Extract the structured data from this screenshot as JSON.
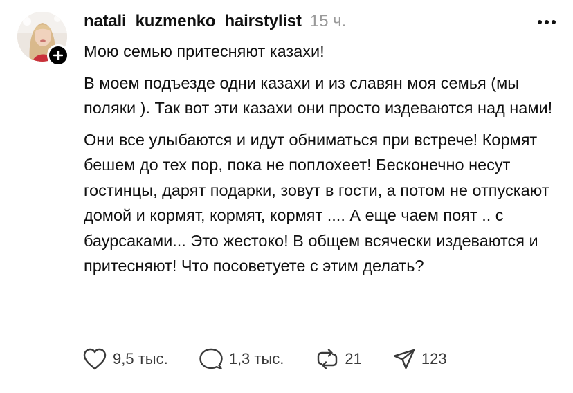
{
  "post": {
    "username": "natali_kuzmenko_hairstylist",
    "timestamp": "15 ч.",
    "paragraphs": [
      "Мою семью притесняют казахи!",
      "В моем подъезде одни казахи и из славян моя семья (мы поляки ). Так вот эти казахи они просто издеваются над нами!",
      "Они все улыбаются и идут обниматься при встрече! Кормят бешем до тех пор, пока не поплохеет! Бесконечно несут гостинцы, дарят подарки, зовут в гости, а потом не отпускают домой и кормят, кормят, кормят .... А еще чаем поят .. с баурсаками... Это жестоко! В общем всячески издеваются и притесняют! Что посоветуете с этим делать?"
    ],
    "actions": {
      "likes": "9,5 тыс.",
      "replies": "1,3 тыс.",
      "reposts": "21",
      "shares": "123"
    }
  },
  "icons": {
    "follow": "plus-icon",
    "more": "more-horizontal-icon",
    "like": "heart-icon",
    "reply": "speech-bubble-icon",
    "repost": "repost-icon",
    "share": "send-icon"
  },
  "colors": {
    "text": "#101010",
    "muted": "#9a9a9a",
    "icon": "#3a3a3a",
    "background": "#ffffff"
  }
}
